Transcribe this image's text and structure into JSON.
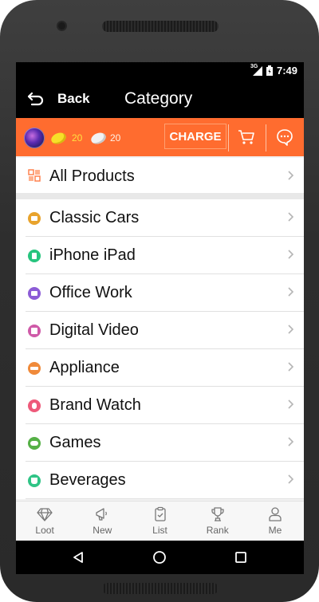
{
  "status_bar": {
    "network": "3G",
    "time": "7:49"
  },
  "header": {
    "back_label": "Back",
    "title": "Category"
  },
  "account_bar": {
    "gold_coins": "20",
    "silver_coins": "20",
    "charge_label": "CHARGE"
  },
  "all_products": {
    "label": "All Products"
  },
  "categories": [
    {
      "label": "Classic Cars",
      "icon": "car-icon",
      "color": "#e8a32c"
    },
    {
      "label": "iPhone iPad",
      "icon": "phone-icon",
      "color": "#27c47e"
    },
    {
      "label": "Office Work",
      "icon": "computer-icon",
      "color": "#8c5cd6"
    },
    {
      "label": "Digital Video",
      "icon": "camera-icon",
      "color": "#cf5aa8"
    },
    {
      "label": "Appliance",
      "icon": "appliance-icon",
      "color": "#f08a3a"
    },
    {
      "label": "Brand Watch",
      "icon": "watch-icon",
      "color": "#ee5a7a"
    },
    {
      "label": "Games",
      "icon": "gamepad-icon",
      "color": "#55b046"
    },
    {
      "label": "Beverages",
      "icon": "cup-icon",
      "color": "#2fc486"
    }
  ],
  "tabs": [
    {
      "label": "Loot",
      "icon": "diamond-icon"
    },
    {
      "label": "New",
      "icon": "megaphone-icon"
    },
    {
      "label": "List",
      "icon": "clipboard-icon"
    },
    {
      "label": "Rank",
      "icon": "trophy-icon"
    },
    {
      "label": "Me",
      "icon": "person-icon"
    }
  ],
  "colors": {
    "accent": "#ff6c2f",
    "header_bg": "#000000"
  }
}
